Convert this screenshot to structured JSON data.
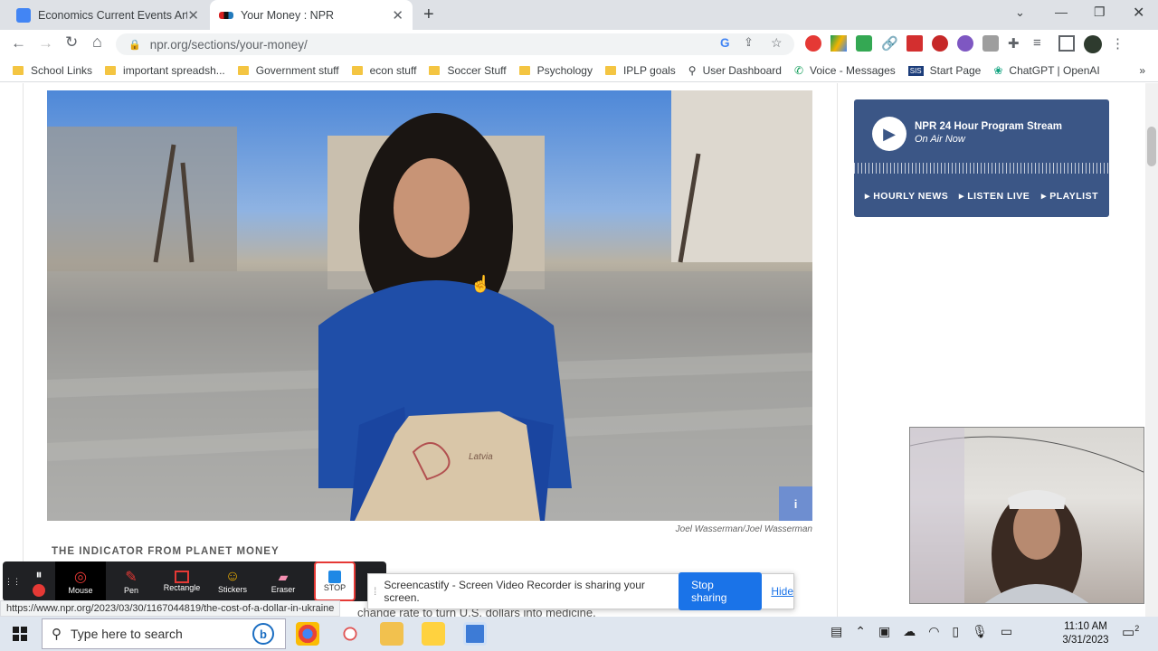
{
  "browser": {
    "tabs": [
      {
        "title": "Economics Current Events Article",
        "active": false
      },
      {
        "title": "Your Money : NPR",
        "active": true
      }
    ],
    "new_tab": "+",
    "url": "npr.org/sections/your-money/",
    "bookmarks": [
      "School Links",
      "important spreadsh...",
      "Government stuff",
      "econ stuff",
      "Soccer Stuff",
      "Psychology",
      "IPLP goals",
      "User Dashboard",
      "Voice - Messages",
      "Start Page",
      "ChatGPT | OpenAI"
    ],
    "more_bookmarks": "»"
  },
  "article": {
    "photo_credit": "Joel Wasserman/Joel Wasserman",
    "info_button": "i",
    "kicker": "THE INDICATOR FROM PLANET MONEY",
    "body_fragment": "change rate to turn U.S. dollars into medicine.",
    "box_text": "Latvia"
  },
  "player": {
    "title": "NPR 24 Hour Program Stream",
    "subtitle": "On Air Now",
    "links": [
      "HOURLY NEWS",
      "LISTEN LIVE",
      "PLAYLIST"
    ]
  },
  "screencastify": {
    "tools": [
      "Mouse",
      "Pen",
      "Rectangle",
      "Stickers",
      "Eraser",
      "STOP"
    ],
    "share_message": "Screencastify - Screen Video Recorder is sharing your screen.",
    "stop_sharing": "Stop sharing",
    "hide": "Hide"
  },
  "status_url": "https://www.npr.org/2023/03/30/1167044819/the-cost-of-a-dollar-in-ukraine",
  "taskbar": {
    "search_placeholder": "Type here to search",
    "time": "11:10 AM",
    "date": "3/31/2023",
    "notification_count": "2"
  },
  "colors": {
    "npr_player": "#3b5686",
    "accent_blue": "#1a73e8",
    "taskbar": "#dfe6ef"
  }
}
